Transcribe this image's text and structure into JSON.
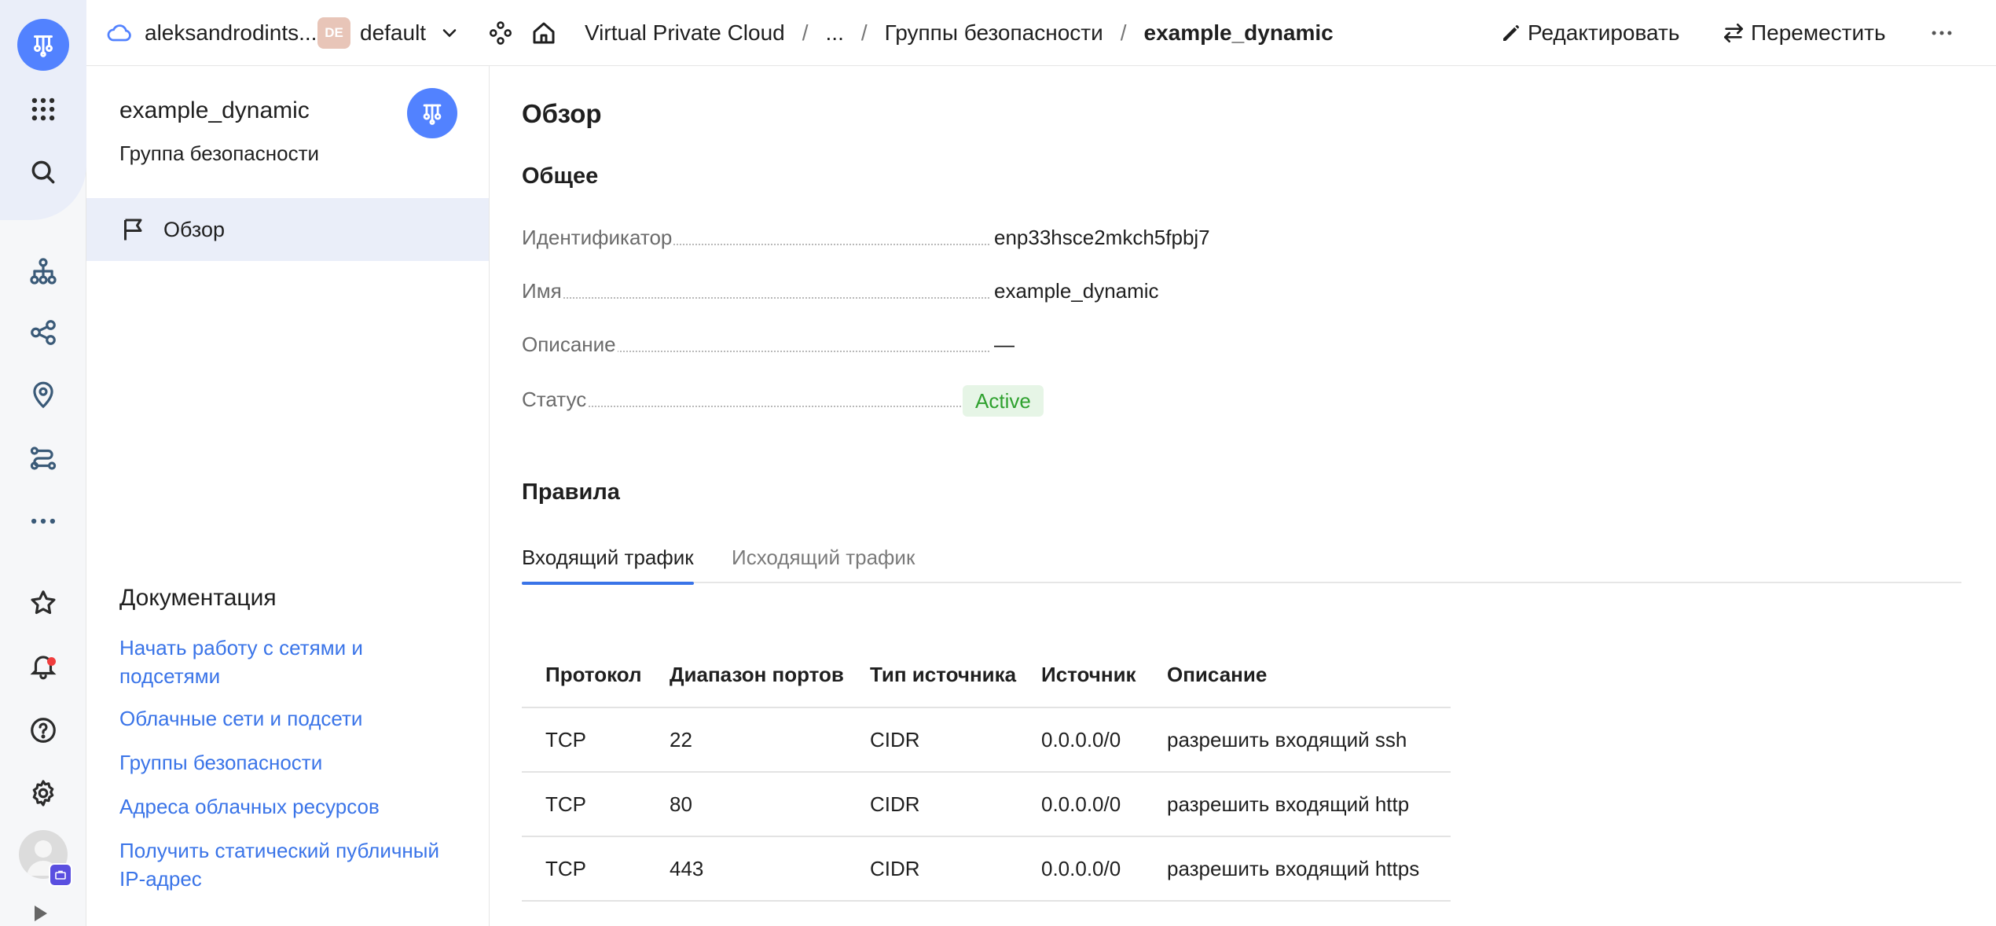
{
  "topbar": {
    "cloud_name": "aleksandrodints...",
    "folder_badge": "DE",
    "folder_name": "default",
    "breadcrumb_service": "Virtual Private Cloud",
    "breadcrumb_sep": "/",
    "breadcrumb_ellipsis": "...",
    "breadcrumb_section": "Группы безопасности",
    "breadcrumb_current": "example_dynamic",
    "edit_label": "Редактировать",
    "move_label": "Переместить"
  },
  "panel": {
    "title": "example_dynamic",
    "subtitle": "Группа безопасности",
    "nav_overview": "Обзор",
    "docs_title": "Документация",
    "doc_links": [
      "Начать работу с сетями и подсетями",
      "Облачные сети и подсети",
      "Группы безопасности",
      "Адреса облачных ресурсов",
      "Получить статический публичный IP-адрес"
    ]
  },
  "main": {
    "overview_heading": "Обзор",
    "general_heading": "Общее",
    "props": {
      "id_label": "Идентификатор",
      "id_value": "enp33hsce2mkch5fpbj7",
      "name_label": "Имя",
      "name_value": "example_dynamic",
      "desc_label": "Описание",
      "desc_value": "—",
      "status_label": "Статус",
      "status_value": "Active"
    },
    "rules_heading": "Правила",
    "tabs": [
      "Входящий трафик",
      "Исходящий трафик"
    ],
    "active_tab": "Входящий трафик",
    "table": {
      "columns": [
        "Протокол",
        "Диапазон портов",
        "Тип источника",
        "Источник",
        "Описание"
      ],
      "rows": [
        [
          "TCP",
          "22",
          "CIDR",
          "0.0.0.0/0",
          "разрешить входящий ssh"
        ],
        [
          "TCP",
          "80",
          "CIDR",
          "0.0.0.0/0",
          "разрешить входящий http"
        ],
        [
          "TCP",
          "443",
          "CIDR",
          "0.0.0.0/0",
          "разрешить входящий https"
        ]
      ]
    }
  },
  "rail": {
    "icons": [
      "logo-icon",
      "apps-grid-icon",
      "search-icon",
      "network-icon",
      "share-nodes-icon",
      "location-pin-icon",
      "route-icon",
      "more-dots-icon",
      "star-icon",
      "bell-icon",
      "help-icon",
      "gear-icon",
      "avatar",
      "expand-icon"
    ]
  },
  "colors": {
    "accent": "#5282ff",
    "link": "#3a74e8",
    "status_active_bg": "#e6f5e6",
    "status_active_text": "#2fa12f",
    "nav_active_bg": "#eaeef9",
    "notification_dot": "#f03e3e"
  }
}
